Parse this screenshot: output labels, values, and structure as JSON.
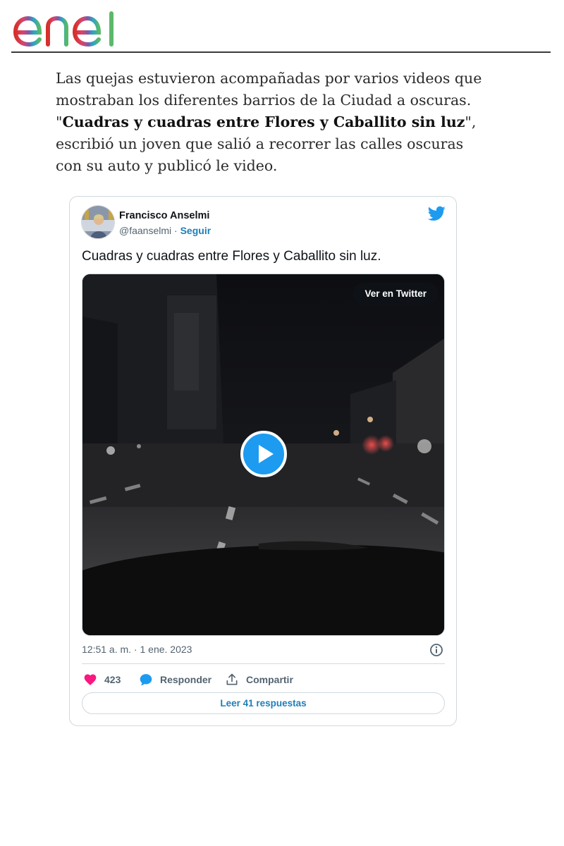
{
  "site": {
    "logo_text": "enel"
  },
  "article": {
    "text_before": "Las quejas estuvieron acompañadas por varios videos que mostraban los diferentes barrios de la Ciudad a oscuras. \"",
    "quote": "Cuadras y cuadras entre Flores y Caballito sin luz",
    "text_after": "\", escribió un joven que salió a recorrer las calles oscuras con su auto y publicó le video."
  },
  "tweet": {
    "author_name": "Francisco Anselmi",
    "handle": "@faanselmi",
    "separator": " · ",
    "follow_label": "Seguir",
    "text": "Cuadras y cuadras entre Flores y Caballito sin luz.",
    "view_on_twitter_label": "Ver en Twitter",
    "timestamp": "12:51 a. m. · 1 ene. 2023",
    "like_count": "423",
    "reply_label": "Responder",
    "share_label": "Compartir",
    "read_replies_label": "Leer 41 respuestas",
    "brand_color": "#1d9bf0",
    "like_color": "#f91880"
  }
}
